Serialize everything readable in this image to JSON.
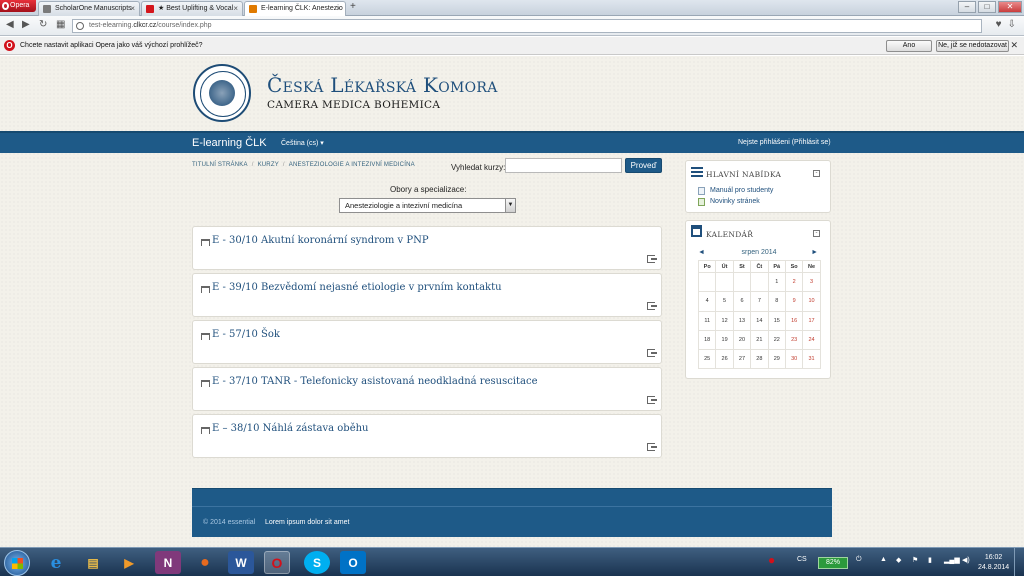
{
  "browser": {
    "menu_label": "Opera",
    "tabs": [
      {
        "title": "ScholarOne Manuscripts",
        "color": "#7a7a7a"
      },
      {
        "title": "★ Best Uplifting & Vocal",
        "color": "#d4161c"
      },
      {
        "title": "E-learning ČLK: Anestezio",
        "color": "#e07a00"
      }
    ],
    "url_prefix": "test-elearning.",
    "url_domain": "clkcr.cz",
    "url_path": "/course/index.php"
  },
  "notification": {
    "text": "Chcete nastavit aplikaci Opera jako váš výchozí prohlížeč?",
    "yes_label": "Ano",
    "no_label": "Ne, již se nedotazovat"
  },
  "site": {
    "title": "Česká Lékařská Komora",
    "subtitle": "CAMERA MEDICA BOHEMICA"
  },
  "navbar": {
    "brand": "E-learning ČLK",
    "language": "Čeština (cs) ▾",
    "login_text": "Nejste přihlášeni (Přihlásit se)"
  },
  "breadcrumb": [
    "Titulní stránka",
    "Kurzy",
    "Anesteziologie a intezivní medicína"
  ],
  "search": {
    "label": "Vyhledat kurzy:",
    "button": "Proveď",
    "value": ""
  },
  "category": {
    "label": "Obory a specializace:",
    "selected": "Anesteziologie a intezivní medicína"
  },
  "courses": [
    {
      "title": "E - 30/10 Akutní koronární syndrom v PNP"
    },
    {
      "title": "E - 39/10 Bezvědomí nejasné etiologie v prvním kontaktu"
    },
    {
      "title": "E - 57/10 Šok"
    },
    {
      "title": "E - 37/10 TANR - Telefonicky asistovaná neodkladná resuscitace"
    },
    {
      "title": "E – 38/10 Náhlá zástava oběhu"
    }
  ],
  "main_menu": {
    "title": "Hlavní nabídka",
    "items": [
      "Manuál pro studenty",
      "Novinky stránek"
    ]
  },
  "calendar": {
    "title": "Kalendář",
    "month": "srpen 2014",
    "prev": "◄",
    "next": "►",
    "weekdays": [
      "Po",
      "Út",
      "St",
      "Čt",
      "Pá",
      "So",
      "Ne"
    ],
    "weeks": [
      [
        "",
        "",
        "",
        "",
        "1",
        "2",
        "3"
      ],
      [
        "4",
        "5",
        "6",
        "7",
        "8",
        "9",
        "10"
      ],
      [
        "11",
        "12",
        "13",
        "14",
        "15",
        "16",
        "17"
      ],
      [
        "18",
        "19",
        "20",
        "21",
        "22",
        "23",
        "24"
      ],
      [
        "25",
        "26",
        "27",
        "28",
        "29",
        "30",
        "31"
      ]
    ]
  },
  "footer": {
    "copyright": "© 2014 essential",
    "text": "Lorem ipsum dolor sit amet"
  },
  "taskbar": {
    "apps": [
      {
        "name": "internet-explorer",
        "glyph": "e",
        "color": "#2a8fe0"
      },
      {
        "name": "file-explorer",
        "glyph": "▤",
        "color": "#e5b94a"
      },
      {
        "name": "media-player",
        "glyph": "▶",
        "color": "#f09a2a"
      },
      {
        "name": "onenote",
        "glyph": "N",
        "color": "#80397b"
      },
      {
        "name": "firefox",
        "glyph": "●",
        "color": "#e66a1f"
      },
      {
        "name": "word",
        "glyph": "W",
        "color": "#2b579a"
      },
      {
        "name": "opera",
        "glyph": "O",
        "color": "#d2101a"
      },
      {
        "name": "skype",
        "glyph": "S",
        "color": "#00aff0"
      },
      {
        "name": "outlook",
        "glyph": "O",
        "color": "#0072c6"
      }
    ],
    "language": "CS",
    "battery": "82%",
    "time": "16:02",
    "date": "24.8.2014"
  }
}
